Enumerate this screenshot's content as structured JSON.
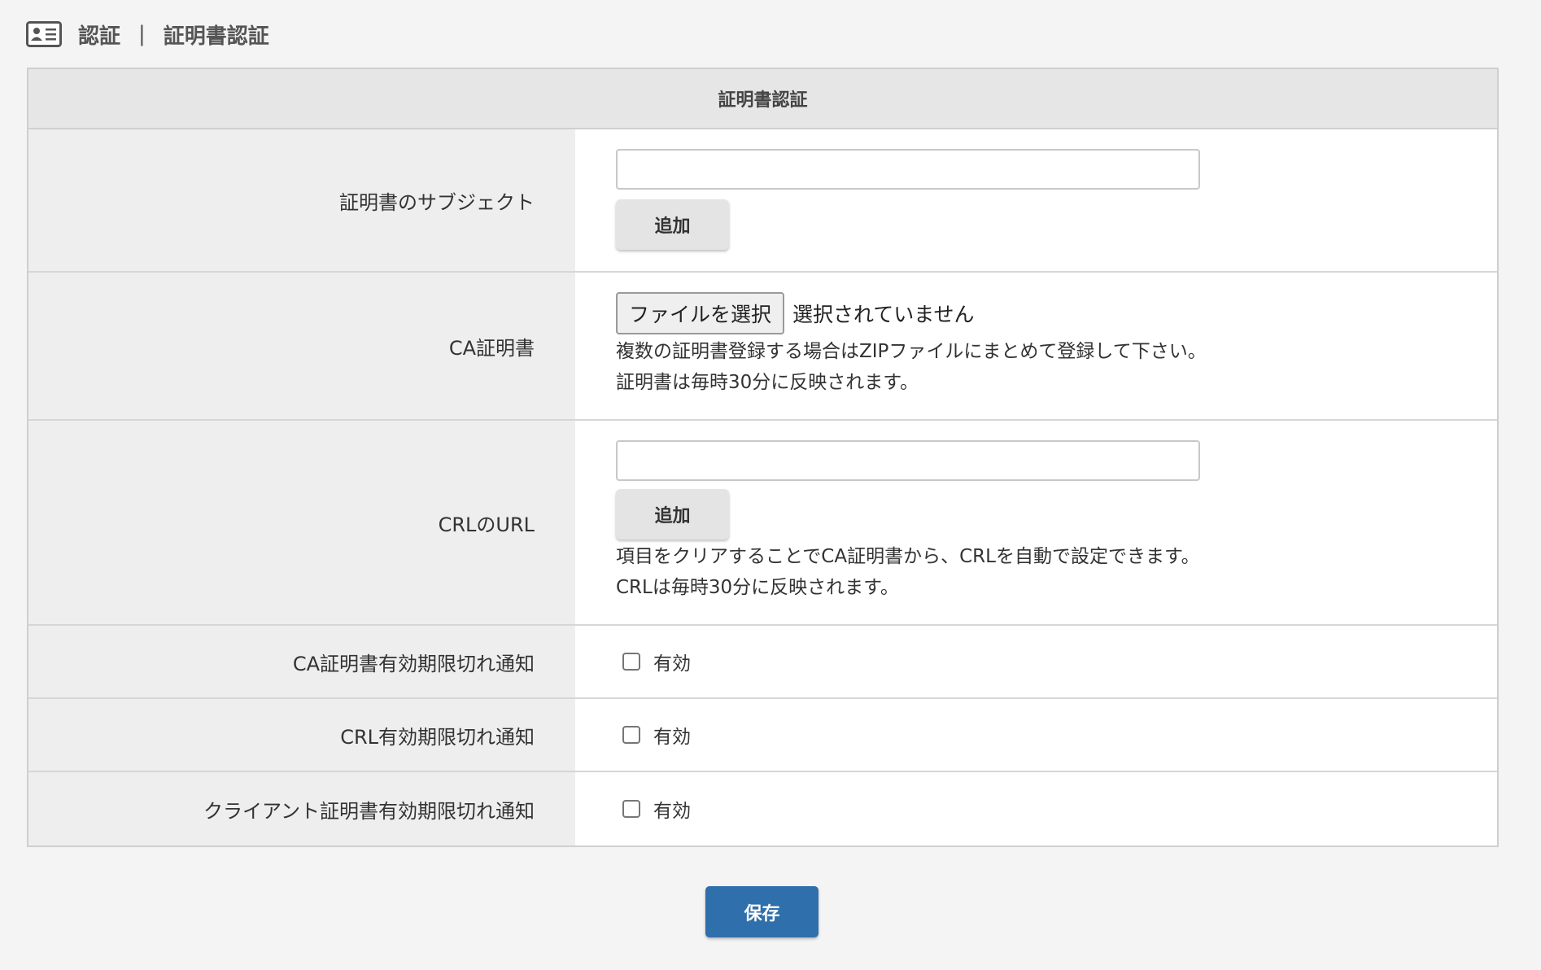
{
  "breadcrumb": {
    "icon": "id-card-icon",
    "parent": "認証",
    "separator": "|",
    "current": "証明書認証"
  },
  "panel": {
    "title": "証明書認証",
    "subject": {
      "label": "証明書のサブジェクト",
      "value": "",
      "add_label": "追加"
    },
    "ca": {
      "label": "CA証明書",
      "file_button": "ファイルを選択",
      "file_status": "選択されていません",
      "notes": [
        "複数の証明書登録する場合はZIPファイルにまとめて登録して下さい。",
        "証明書は毎時30分に反映されます。"
      ]
    },
    "crl": {
      "label": "CRLのURL",
      "value": "",
      "add_label": "追加",
      "notes": [
        "項目をクリアすることでCA証明書から、CRLを自動で設定できます。",
        "CRLは毎時30分に反映されます。"
      ]
    },
    "ca_expiry": {
      "label": "CA証明書有効期限切れ通知",
      "checkbox_label": "有効",
      "checked": false
    },
    "crl_expiry": {
      "label": "CRL有効期限切れ通知",
      "checkbox_label": "有効",
      "checked": false
    },
    "client_expiry": {
      "label": "クライアント証明書有効期限切れ通知",
      "checkbox_label": "有効",
      "checked": false
    }
  },
  "save_label": "保存",
  "colors": {
    "primary": "#2f6fab",
    "header_bg": "#e6e6e6",
    "label_bg": "#eeeeee",
    "page_bg": "#f4f4f4"
  }
}
